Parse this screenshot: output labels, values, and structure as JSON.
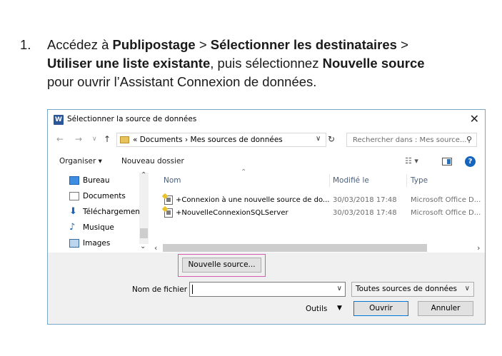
{
  "step": {
    "number": "1.",
    "t1": "Accédez à ",
    "b1": "Publipostage",
    "t2": " > ",
    "b2": "Sélectionner les destinataires",
    "t3": " > ",
    "b3": "Utiliser une liste existante",
    "t4": ", puis sélectionnez ",
    "b4": "Nouvelle source",
    "t5": " pour ouvrir l’Assistant Connexion de données."
  },
  "dialog": {
    "app_icon_letter": "W",
    "title": "Sélectionner la source de données",
    "close_glyph": "✕",
    "nav": {
      "back": "←",
      "forward": "→",
      "recent": "∨",
      "up": "↑",
      "crumbs": "«  Documents  ›  Mes sources de données",
      "refresh": "↻",
      "search_placeholder": "Rechercher dans : Mes source...",
      "search_icon": "⚲"
    },
    "toolbar": {
      "organize": "Organiser ▾",
      "new_folder": "Nouveau dossier",
      "view": "☷ ▾",
      "help": "?"
    },
    "sidebar": [
      {
        "label": "Bureau",
        "icon": "desktop-icon"
      },
      {
        "label": "Documents",
        "icon": "documents-icon"
      },
      {
        "label": "Téléchargement",
        "icon": "download-icon"
      },
      {
        "label": "Musique",
        "icon": "music-icon"
      },
      {
        "label": "Images",
        "icon": "images-icon"
      }
    ],
    "columns": {
      "name": "Nom",
      "modified": "Modifié le",
      "type": "Type"
    },
    "files": [
      {
        "name": "+Connexion à une nouvelle source de do...",
        "modified": "30/03/2018 17:48",
        "type": "Microsoft Office D..."
      },
      {
        "name": "+NouvelleConnexionSQLServer",
        "modified": "30/03/2018 17:48",
        "type": "Microsoft Office D..."
      }
    ],
    "new_source_button": "Nouvelle source...",
    "filename_label": "Nom de fichier :",
    "filename_value": "",
    "filter_value": "Toutes sources de données",
    "tools_label": "Outils",
    "open_button": "Ouvrir",
    "cancel_button": "Annuler"
  }
}
